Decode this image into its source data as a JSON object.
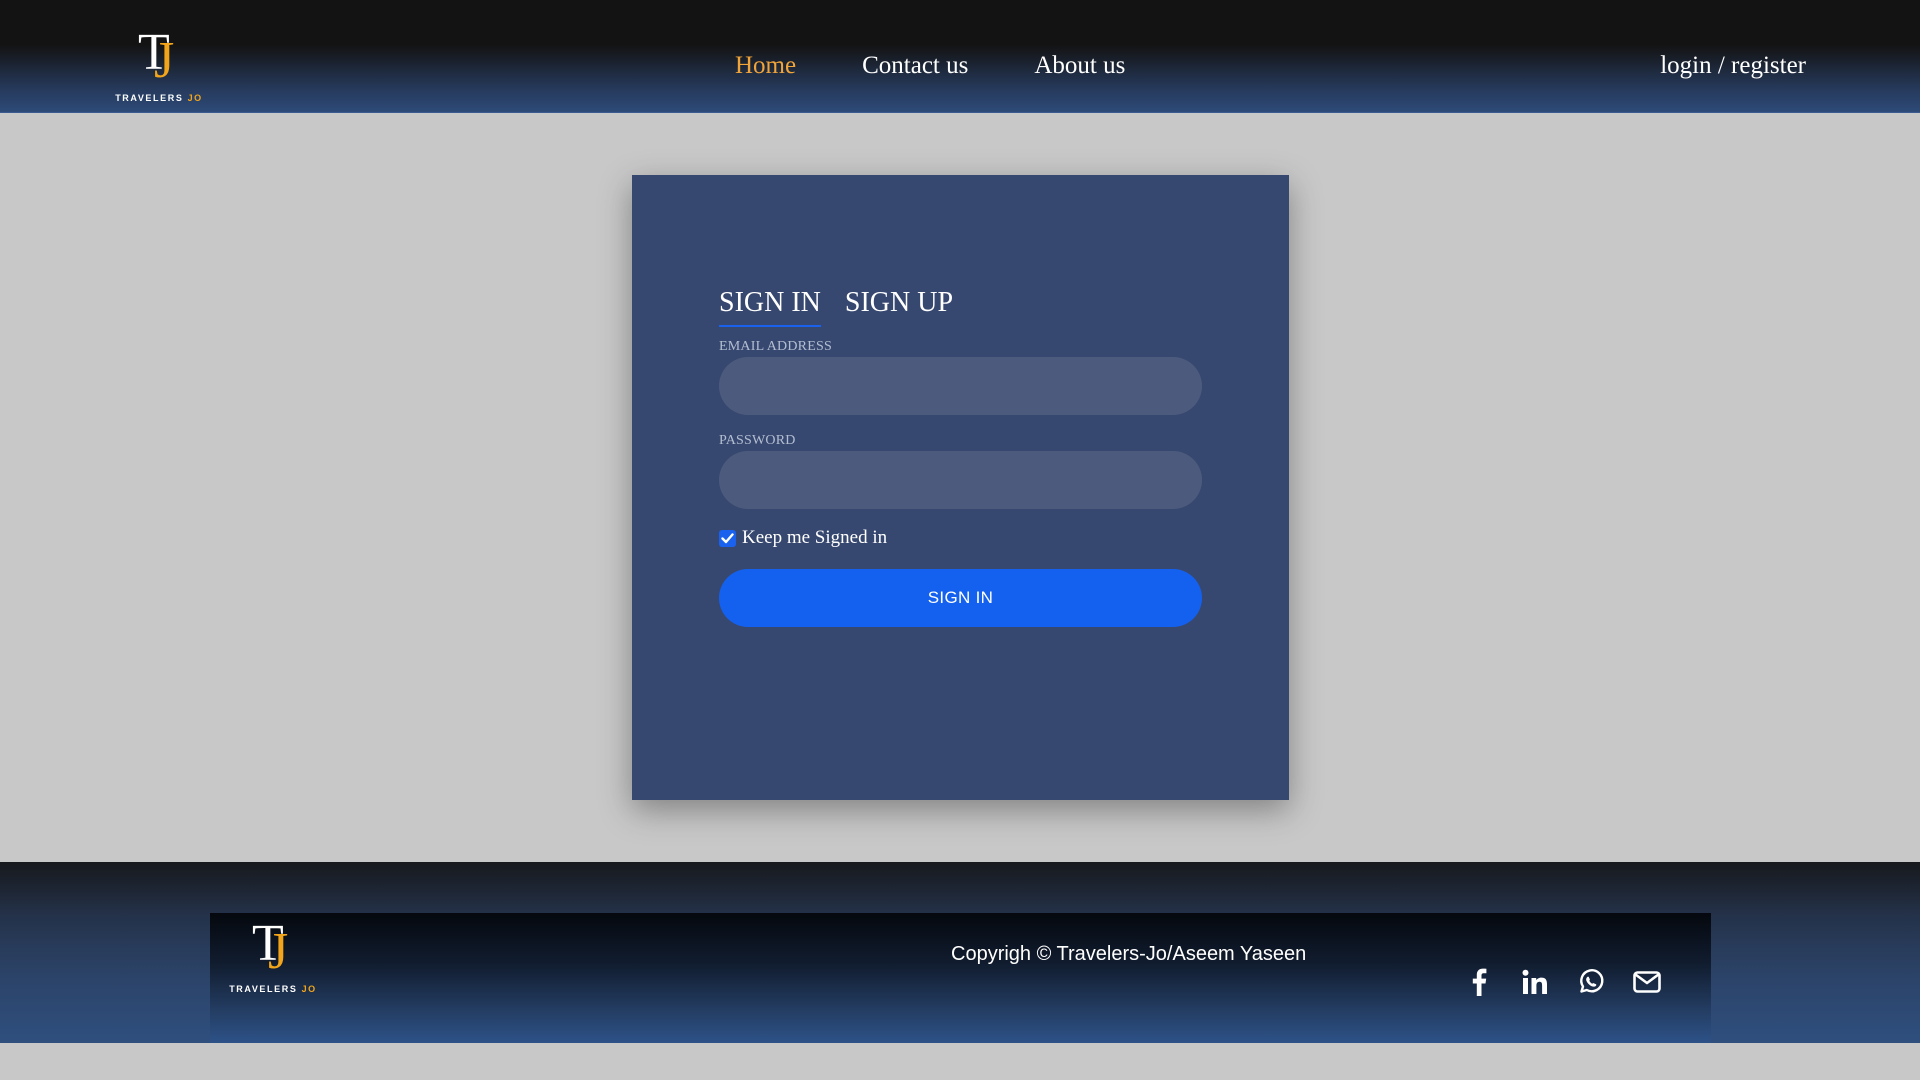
{
  "brand": {
    "logo_letter_t": "T",
    "logo_letter_j": "J",
    "logo_name": "TRAVELERS",
    "logo_name_suffix": "JO",
    "accent_color": "#f2a51a"
  },
  "nav": {
    "items": [
      {
        "label": "Home",
        "active": true
      },
      {
        "label": "Contact us",
        "active": false
      },
      {
        "label": "About us",
        "active": false
      }
    ],
    "auth_link": "login / register"
  },
  "auth": {
    "tabs": [
      {
        "label": "SIGN IN",
        "active": true
      },
      {
        "label": "SIGN UP",
        "active": false
      }
    ],
    "email_label": "EMAIL ADDRESS",
    "email_value": "",
    "password_label": "PASSWORD",
    "password_value": "",
    "remember_label": "Keep me Signed in",
    "remember_checked": true,
    "submit_label": "SIGN IN",
    "card_color": "#374870",
    "button_color": "#1461ef"
  },
  "footer": {
    "copyright": "Copyrigh © Travelers-Jo/Aseem Yaseen",
    "social_icons": [
      "facebook-icon",
      "linkedin-icon",
      "whatsapp-icon",
      "email-icon"
    ]
  }
}
